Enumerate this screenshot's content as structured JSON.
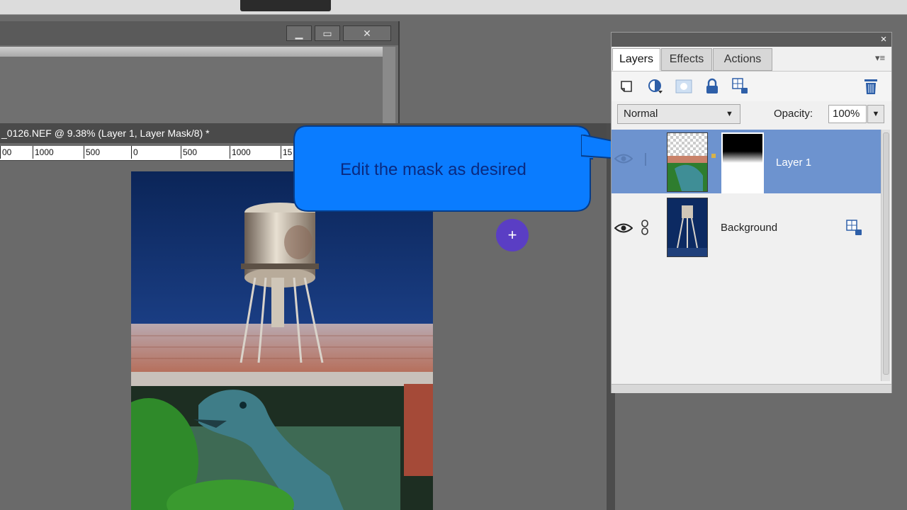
{
  "document": {
    "title": "_0126.NEF @ 9.38% (Layer 1, Layer Mask/8) *",
    "ruler_ticks": [
      "00",
      "1000",
      "500",
      "0",
      "500",
      "1000",
      "15"
    ]
  },
  "window_controls": {
    "minimize": "▁",
    "restore": "▭",
    "close": "✕"
  },
  "callout": {
    "text": "Edit the mask as desired"
  },
  "cursor": {
    "symbol": "+"
  },
  "layers_panel": {
    "close": "×",
    "tabs": [
      "Layers",
      "Effects",
      "Actions"
    ],
    "menu": "▾≡",
    "blend_mode": "Normal",
    "opacity_label": "Opacity:",
    "opacity_value": "100%",
    "layers": [
      {
        "name": "Layer 1",
        "selected": true
      },
      {
        "name": "Background",
        "selected": false
      }
    ]
  },
  "colors": {
    "accent_selection": "#6d93cf",
    "callout_fill": "#0a7cff",
    "cursor": "#5a3ec4"
  }
}
